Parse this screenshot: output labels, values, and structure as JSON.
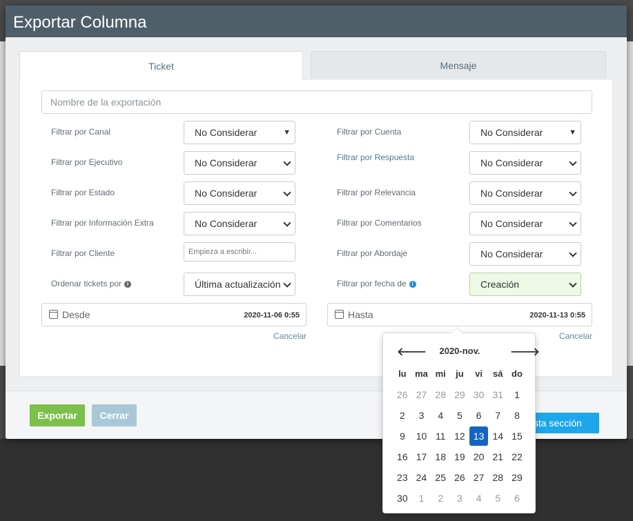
{
  "modal": {
    "title": "Exportar Columna"
  },
  "tabs": [
    {
      "label": "Ticket",
      "active": true
    },
    {
      "label": "Mensaje",
      "active": false
    }
  ],
  "name_field": {
    "placeholder": "Nombre de la exportación"
  },
  "filters_left": [
    {
      "label": "Filtrar por Canal",
      "value": "No Considerar"
    },
    {
      "label": "Filtrar por Ejecutivo",
      "value": "No Considerar"
    },
    {
      "label": "Filtrar por Estado",
      "value": "No Considerar"
    },
    {
      "label": "Filtrar por Información Extra",
      "value": "No Considerar"
    },
    {
      "label": "Filtrar por Cliente",
      "placeholder": "Empieza a escribir..."
    },
    {
      "label": "Ordenar tickets por",
      "value": "Última actualización"
    }
  ],
  "filters_right": [
    {
      "label": "Filtrar por Cuenta",
      "value": "No Considerar"
    },
    {
      "label": "Filtrar por Respuesta",
      "value": "No Considerar"
    },
    {
      "label": "Filtrar por Relevancia",
      "value": "No Considerar"
    },
    {
      "label": "Filtrar por Comentarios",
      "value": "No Considerar"
    },
    {
      "label": "Filtrar por Abordaje",
      "value": "No Considerar"
    },
    {
      "label": "Filtrar por fecha de",
      "value": "Creación"
    }
  ],
  "dates": {
    "from": {
      "label": "Desde",
      "value": "2020-11-06 0:55",
      "cancel": "Cancelar"
    },
    "to": {
      "label": "Hasta",
      "value": "2020-11-13 0:55",
      "cancel": "Cancelar"
    }
  },
  "footer": {
    "export_label": "Exportar",
    "close_label": "Cerrar",
    "section_label": "esta sección"
  },
  "datepicker": {
    "title": "2020-nov.",
    "prev": "🡐",
    "next": "🡒",
    "weekdays": [
      "lu",
      "ma",
      "mi",
      "ju",
      "vi",
      "sá",
      "do"
    ],
    "weeks": [
      [
        "26",
        "27",
        "28",
        "29",
        "30",
        "31",
        "1"
      ],
      [
        "2",
        "3",
        "4",
        "5",
        "6",
        "7",
        "8"
      ],
      [
        "9",
        "10",
        "11",
        "12",
        "13",
        "14",
        "15"
      ],
      [
        "16",
        "17",
        "18",
        "19",
        "20",
        "21",
        "22"
      ],
      [
        "23",
        "24",
        "25",
        "26",
        "27",
        "28",
        "29"
      ],
      [
        "30",
        "1",
        "2",
        "3",
        "4",
        "5",
        "6"
      ]
    ],
    "selected_day": "13"
  },
  "colors": {
    "header_bg": "#4e5f6a",
    "export_btn": "#7cc04b",
    "close_btn": "#a8c8d8",
    "section_btn": "#1ea6ea",
    "selected_day": "#1565c0",
    "date_filter_bg": "#eef9e6"
  }
}
